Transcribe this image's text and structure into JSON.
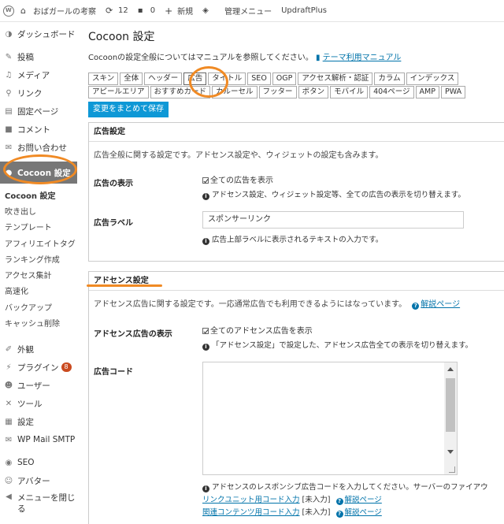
{
  "adminbar": {
    "site_name": "おばガールの考察",
    "updates_count": "12",
    "comments_count": "0",
    "new_label": "新規",
    "manage_menu": "管理メニュー",
    "updraft": "UpdraftPlus"
  },
  "sidebar": {
    "items": [
      {
        "label": "ダッシュボード",
        "icon": "gauge-icon"
      },
      {
        "label": "投稿",
        "icon": "pin-icon"
      },
      {
        "label": "メディア",
        "icon": "media-icon"
      },
      {
        "label": "リンク",
        "icon": "link-icon"
      },
      {
        "label": "固定ページ",
        "icon": "page-icon"
      },
      {
        "label": "コメント",
        "icon": "comment-icon"
      },
      {
        "label": "お問い合わせ",
        "icon": "mail-icon"
      }
    ],
    "current": {
      "label": "Cocoon 設定",
      "icon": "cocoon-icon"
    },
    "submenu": [
      "Cocoon 設定",
      "吹き出し",
      "テンプレート",
      "アフィリエイトタグ",
      "ランキング作成",
      "アクセス集計",
      "高速化",
      "バックアップ",
      "キャッシュ削除"
    ],
    "items_after": [
      {
        "label": "外観",
        "icon": "brush-icon"
      },
      {
        "label": "プラグイン",
        "icon": "plugin-icon",
        "badge": "8"
      },
      {
        "label": "ユーザー",
        "icon": "user-icon"
      },
      {
        "label": "ツール",
        "icon": "wrench-icon"
      },
      {
        "label": "設定",
        "icon": "settings-icon"
      },
      {
        "label": "WP Mail SMTP",
        "icon": "smtp-icon"
      },
      {
        "label": "SEO",
        "icon": "seo-icon"
      },
      {
        "label": "アバター",
        "icon": "avatar-icon"
      },
      {
        "label": "メニューを閉じる",
        "icon": "collapse-icon"
      }
    ]
  },
  "main": {
    "title": "Cocoon 設定",
    "intro": "Cocoonの設定全般についてはマニュアルを参照してください。",
    "manual_link": "テーマ利用マニュアル",
    "tabs_row1": [
      "スキン",
      "全体",
      "ヘッダー",
      "広告",
      "タイトル",
      "SEO",
      "OGP",
      "アクセス解析・認証",
      "カラム",
      "インデックス"
    ],
    "tabs_row2": [
      "アピールエリア",
      "おすすめカード",
      "カルーセル",
      "フッター",
      "ボタン",
      "モバイル",
      "404ページ",
      "AMP",
      "PWA"
    ],
    "active_tab": "広告",
    "save_label": "変更をまとめて保存"
  },
  "ad_settings": {
    "header": "広告設定",
    "desc": "広告全般に関する設定です。アドセンス設定や、ウィジェットの設定も含みます。",
    "show_label": "広告の表示",
    "show_checkbox": "全ての広告を表示",
    "show_info": "アドセンス設定、ウィジェット設定等、全ての広告の表示を切り替えます。",
    "ad_label_label": "広告ラベル",
    "ad_label_value": "スポンサーリンク",
    "ad_label_info": "広告上部ラベルに表示されるテキストの入力です。"
  },
  "adsense": {
    "header": "アドセンス設定",
    "desc": "アドセンス広告に関する設定です。一応通常広告でも利用できるようにはなっています。",
    "help_link": "解説ページ",
    "show_label": "アドセンス広告の表示",
    "show_checkbox": "全てのアドセンス広告を表示",
    "show_info": "「アドセンス設定」で設定した、アドセンス広告全ての表示を切り替えます。",
    "code_label": "広告コード",
    "code_info": "アドセンスのレスポンシブ広告コードを入力してください。サーバーのファイアウ",
    "link_unit_label": "リンクユニット用コード入力",
    "link_unit_suffix": "[未入力]",
    "link_unit_help": "解説ページ",
    "related_label": "関連コンテンツ用コード入力",
    "related_suffix": "[未入力]",
    "related_help": "解説ページ"
  },
  "colors": {
    "annotation": "#f08a24",
    "save_button": "#0e98d6",
    "link": "#0073aa"
  }
}
